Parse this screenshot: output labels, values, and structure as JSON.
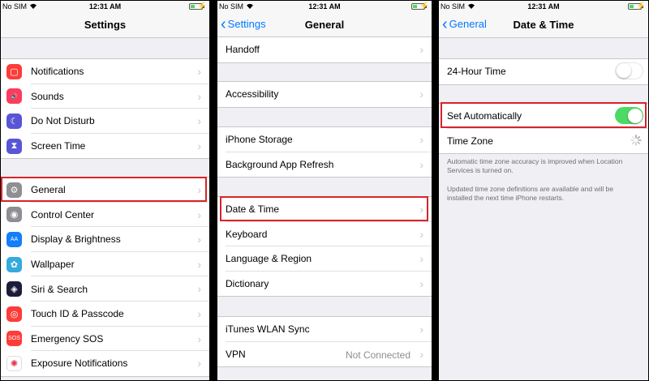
{
  "status_bar": {
    "carrier": "No SIM",
    "time": "12:31 AM"
  },
  "colors": {
    "accent": "#007aff",
    "highlight": "#d8232a",
    "toggle_on": "#4cd964"
  },
  "panel1": {
    "title": "Settings",
    "group1": [
      {
        "label": "Notifications",
        "icon": "notifications-icon",
        "color": "#fc3d39",
        "glyph": "▢"
      },
      {
        "label": "Sounds",
        "icon": "speaker-icon",
        "color": "#fd3b5d",
        "glyph": "🔊"
      },
      {
        "label": "Do Not Disturb",
        "icon": "moon-icon",
        "color": "#5856d6",
        "glyph": "☾"
      },
      {
        "label": "Screen Time",
        "icon": "hourglass-icon",
        "color": "#5856d6",
        "glyph": "⧗"
      }
    ],
    "group2": [
      {
        "label": "General",
        "icon": "gear-icon",
        "color": "#8e8e93",
        "glyph": "⚙"
      },
      {
        "label": "Control Center",
        "icon": "switches-icon",
        "color": "#8e8e93",
        "glyph": "◉"
      },
      {
        "label": "Display & Brightness",
        "icon": "text-size-icon",
        "color": "#147efb",
        "glyph": "AA"
      },
      {
        "label": "Wallpaper",
        "icon": "flower-icon",
        "color": "#35aadc",
        "glyph": "✿"
      },
      {
        "label": "Siri & Search",
        "icon": "siri-icon",
        "color": "#1c1c3a",
        "glyph": "◈"
      },
      {
        "label": "Touch ID & Passcode",
        "icon": "fingerprint-icon",
        "color": "#fc3d39",
        "glyph": "◎"
      },
      {
        "label": "Emergency SOS",
        "icon": "sos-icon",
        "color": "#fc3d39",
        "glyph": "SOS"
      },
      {
        "label": "Exposure Notifications",
        "icon": "exposure-icon",
        "color": "#ffffff",
        "glyph": "✺"
      }
    ]
  },
  "panel2": {
    "back": "Settings",
    "title": "General",
    "group0": [
      {
        "label": "Handoff"
      }
    ],
    "group1": [
      {
        "label": "Accessibility"
      }
    ],
    "group2": [
      {
        "label": "iPhone Storage"
      },
      {
        "label": "Background App Refresh"
      }
    ],
    "group3": [
      {
        "label": "Date & Time"
      },
      {
        "label": "Keyboard"
      },
      {
        "label": "Language & Region"
      },
      {
        "label": "Dictionary"
      }
    ],
    "group4": [
      {
        "label": "iTunes WLAN Sync"
      },
      {
        "label": "VPN",
        "value": "Not Connected"
      }
    ]
  },
  "panel3": {
    "back": "General",
    "title": "Date & Time",
    "hour24": {
      "label": "24-Hour Time",
      "on": false
    },
    "set_auto": {
      "label": "Set Automatically",
      "on": true
    },
    "time_zone": {
      "label": "Time Zone"
    },
    "note1": "Automatic time zone accuracy is improved when Location Services is turned on.",
    "note2": "Updated time zone definitions are available and will be installed the next time iPhone restarts."
  }
}
